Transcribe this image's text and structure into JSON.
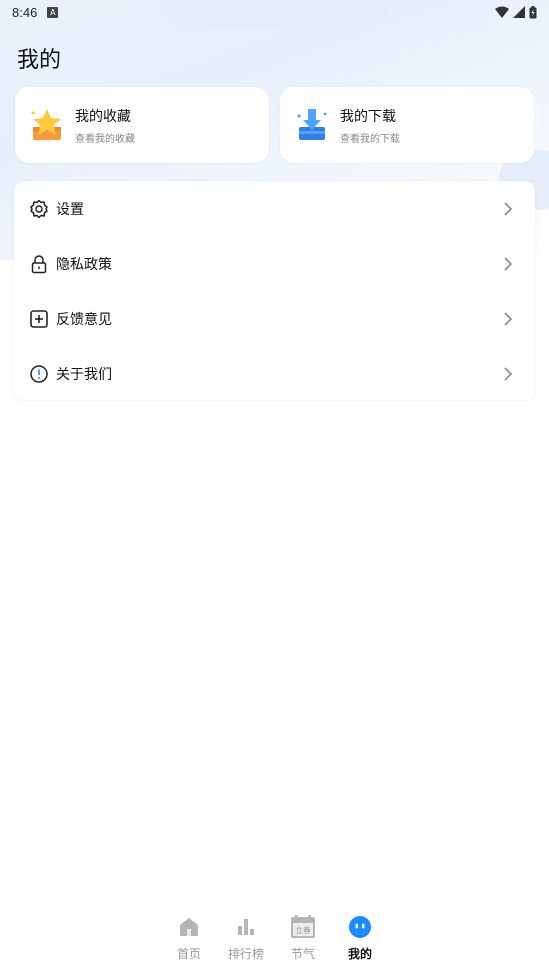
{
  "status_bar": {
    "time": "8:46"
  },
  "page_title": "我的",
  "cards": [
    {
      "title": "我的收藏",
      "subtitle": "查看我的收藏",
      "icon": "star-box-icon"
    },
    {
      "title": "我的下载",
      "subtitle": "查看我的下载",
      "icon": "download-box-icon"
    }
  ],
  "menu": [
    {
      "label": "设置",
      "icon": "gear-icon"
    },
    {
      "label": "隐私政策",
      "icon": "lock-icon"
    },
    {
      "label": "反馈意见",
      "icon": "plus-square-icon"
    },
    {
      "label": "关于我们",
      "icon": "info-circle-icon"
    }
  ],
  "tabs": [
    {
      "label": "首页",
      "icon": "home-icon"
    },
    {
      "label": "排行榜",
      "icon": "bar-chart-icon"
    },
    {
      "label": "节气",
      "icon": "calendar-icon",
      "icon_text": "立春"
    },
    {
      "label": "我的",
      "icon": "profile-icon",
      "active": true
    }
  ],
  "colors": {
    "accent": "#1a8cff",
    "inactive": "#999999"
  }
}
